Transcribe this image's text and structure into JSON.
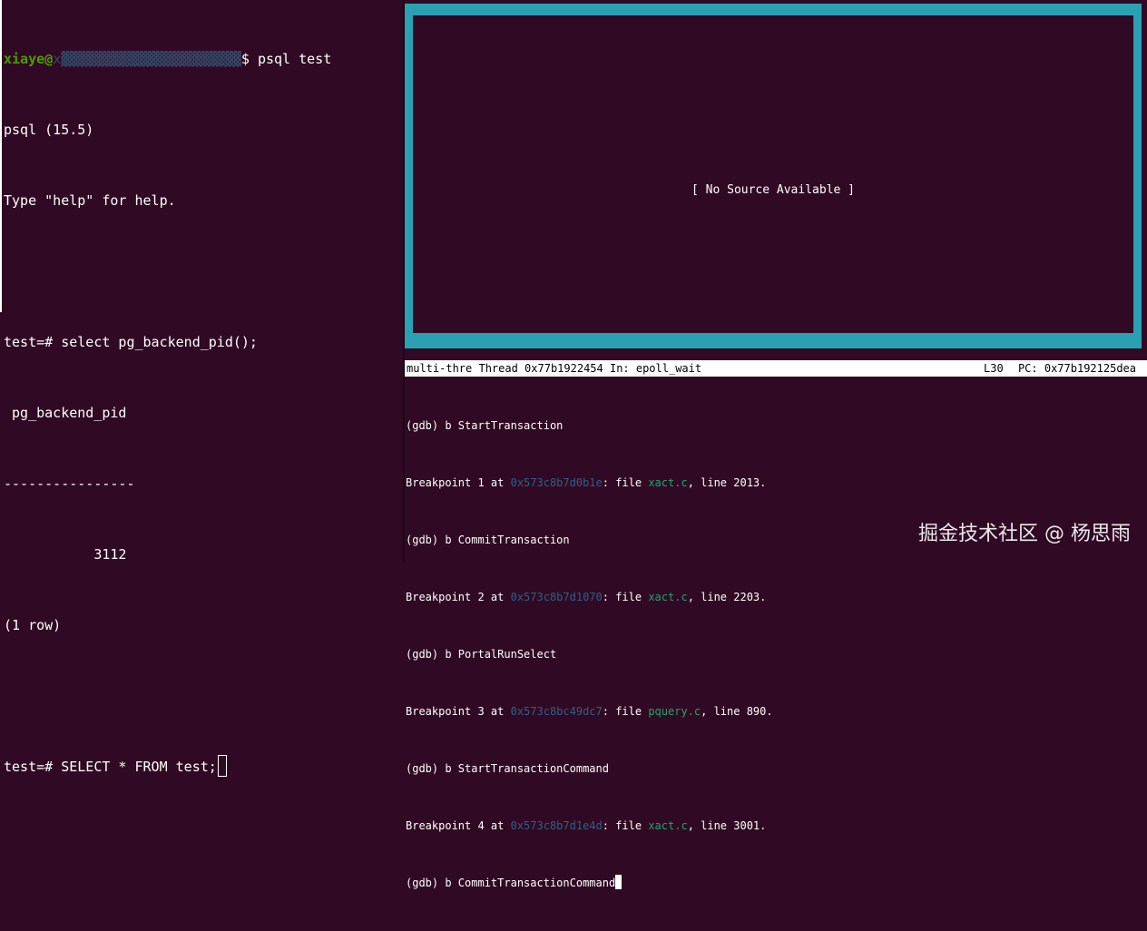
{
  "left_terminal": {
    "prompt_user": "xiaye@",
    "prompt_host_redacted": "x▓▓▓▓▓▓▓▓▓▓▓▓▓▓▓▓▓▓▓▓▓▓",
    "prompt_cmd": "$ psql test",
    "lines": [
      "psql (15.5)",
      "Type \"help\" for help.",
      "",
      "test=# select pg_backend_pid();",
      " pg_backend_pid",
      "----------------",
      "           3112",
      "(1 row)",
      ""
    ],
    "current_input": "test=# SELECT * FROM test;"
  },
  "gdb_source": {
    "no_source_text": "[ No Source Available ]"
  },
  "status_bar": {
    "left": "multi-thre Thread 0x77b1922454 In: epoll_wait",
    "line": "L30",
    "pc": "PC: 0x77b192125dea"
  },
  "gdb_console": {
    "cmd1": "(gdb) b StartTransaction",
    "bp1": {
      "prefix": "Breakpoint 1 at ",
      "addr": "0x573c8b7d0b1e",
      "mid": ": file ",
      "file": "xact.c",
      "suffix": ", line 2013."
    },
    "cmd2": "(gdb) b CommitTransaction",
    "bp2": {
      "prefix": "Breakpoint 2 at ",
      "addr": "0x573c8b7d1070",
      "mid": ": file ",
      "file": "xact.c",
      "suffix": ", line 2203."
    },
    "cmd3": "(gdb) b PortalRunSelect",
    "bp3": {
      "prefix": "Breakpoint 3 at ",
      "addr": "0x573c8bc49dc7",
      "mid": ": file ",
      "file": "pquery.c",
      "suffix": ", line 890."
    },
    "cmd4": "(gdb) b StartTransactionCommand",
    "bp4": {
      "prefix": "Breakpoint 4 at ",
      "addr": "0x573c8b7d1e4d",
      "mid": ": file ",
      "file": "xact.c",
      "suffix": ", line 3001."
    },
    "current_input": "(gdb) b CommitTransactionCommand"
  },
  "watermark": "掘金技术社区 @ 杨思雨"
}
